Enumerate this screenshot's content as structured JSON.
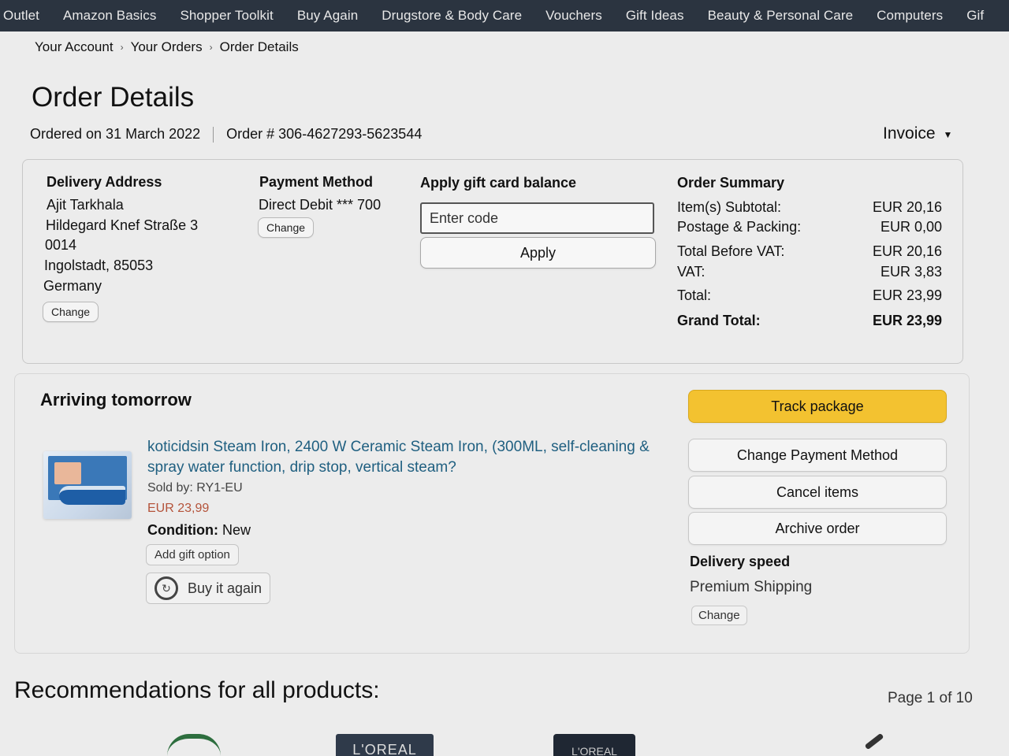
{
  "topnav": {
    "items": [
      "Outlet",
      "Amazon Basics",
      "Shopper Toolkit",
      "Buy Again",
      "Drugstore & Body Care",
      "Vouchers",
      "Gift Ideas",
      "Beauty & Personal Care",
      "Computers",
      "Gif"
    ]
  },
  "breadcrumb": [
    "Your Account",
    "Your Orders",
    "Order Details"
  ],
  "page_title": "Order Details",
  "order": {
    "ordered_on": "Ordered on 31 March 2022",
    "order_number": "Order # 306-4627293-5623544",
    "invoice_label": "Invoice"
  },
  "delivery_address": {
    "title": "Delivery Address",
    "lines": [
      "Ajit Tarkhala",
      "Hildegard Knef Straße 3",
      "0014",
      "Ingolstadt, 85053",
      "Germany"
    ],
    "change_label": "Change"
  },
  "payment_method": {
    "title": "Payment Method",
    "value": "Direct Debit *** 700",
    "change_label": "Change"
  },
  "gift_card": {
    "title": "Apply gift card balance",
    "placeholder": "Enter code",
    "apply_label": "Apply"
  },
  "order_summary": {
    "title": "Order Summary",
    "rows": [
      {
        "label": "Item(s) Subtotal:",
        "value": "EUR 20,16"
      },
      {
        "label": "Postage & Packing:",
        "value": "EUR 0,00"
      },
      {
        "label": "Total Before VAT:",
        "value": "EUR 20,16"
      },
      {
        "label": "VAT:",
        "value": "EUR 3,83"
      },
      {
        "label": "Total:",
        "value": "EUR 23,99"
      },
      {
        "label": "Grand Total:",
        "value": "EUR 23,99"
      }
    ]
  },
  "shipment": {
    "status": "Arriving tomorrow",
    "product_title": "koticidsin Steam Iron, 2400 W Ceramic Steam Iron, (300ML, self-cleaning & spray water function, drip stop, vertical steam?",
    "sold_by": "Sold by: RY1-EU",
    "price": "EUR 23,99",
    "condition_label": "Condition:",
    "condition_value": "New",
    "gift_option_label": "Add gift option",
    "buy_again_label": "Buy it again",
    "actions": {
      "track": "Track package",
      "change_payment": "Change Payment Method",
      "cancel": "Cancel items",
      "archive": "Archive order"
    },
    "delivery_speed_title": "Delivery speed",
    "delivery_speed_value": "Premium Shipping",
    "delivery_speed_change": "Change"
  },
  "recommendations": {
    "title": "Recommendations for all products:",
    "page_indicator": "Page 1 of 10",
    "thumb_texts": [
      "L'OREAL",
      "L'OREAL"
    ]
  },
  "colors": {
    "nav_bg": "#2b3440",
    "page_bg": "#ececec",
    "link": "#1f5f80",
    "price": "#b4533a",
    "primary_button": "#f3c230"
  }
}
